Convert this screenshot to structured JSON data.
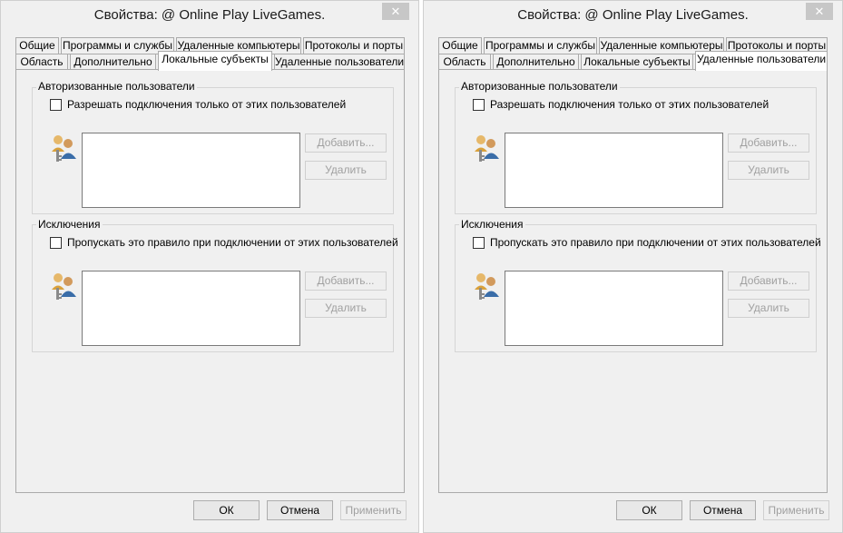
{
  "windows": [
    {
      "title": "Свойства: @ Online Play LiveGames.",
      "close": "✕",
      "tabs_row1": [
        "Общие",
        "Программы и службы",
        "Удаленные компьютеры",
        "Протоколы и порты"
      ],
      "tabs_row2": [
        "Область",
        "Дополнительно",
        "Локальные субъекты",
        "Удаленные пользователи"
      ],
      "active_tab": "Локальные субъекты",
      "authorized": {
        "group_label": "Авторизованные пользователи",
        "checkbox_label": "Разрешать подключения только от этих пользователей",
        "add": "Добавить...",
        "remove": "Удалить"
      },
      "exceptions": {
        "group_label": "Исключения",
        "checkbox_label": "Пропускать это правило при подключении от этих пользователей",
        "add": "Добавить...",
        "remove": "Удалить"
      },
      "footer": {
        "ok": "ОК",
        "cancel": "Отмена",
        "apply": "Применить"
      }
    },
    {
      "title": "Свойства: @ Online Play LiveGames.",
      "close": "✕",
      "tabs_row1": [
        "Общие",
        "Программы и службы",
        "Удаленные компьютеры",
        "Протоколы и порты"
      ],
      "tabs_row2": [
        "Область",
        "Дополнительно",
        "Локальные субъекты",
        "Удаленные пользователи"
      ],
      "active_tab": "Удаленные пользователи",
      "authorized": {
        "group_label": "Авторизованные пользователи",
        "checkbox_label": "Разрешать подключения только от этих пользователей",
        "add": "Добавить...",
        "remove": "Удалить"
      },
      "exceptions": {
        "group_label": "Исключения",
        "checkbox_label": "Пропускать это правило при подключении от этих пользователей",
        "add": "Добавить...",
        "remove": "Удалить"
      },
      "footer": {
        "ok": "ОК",
        "cancel": "Отмена",
        "apply": "Применить"
      }
    }
  ]
}
